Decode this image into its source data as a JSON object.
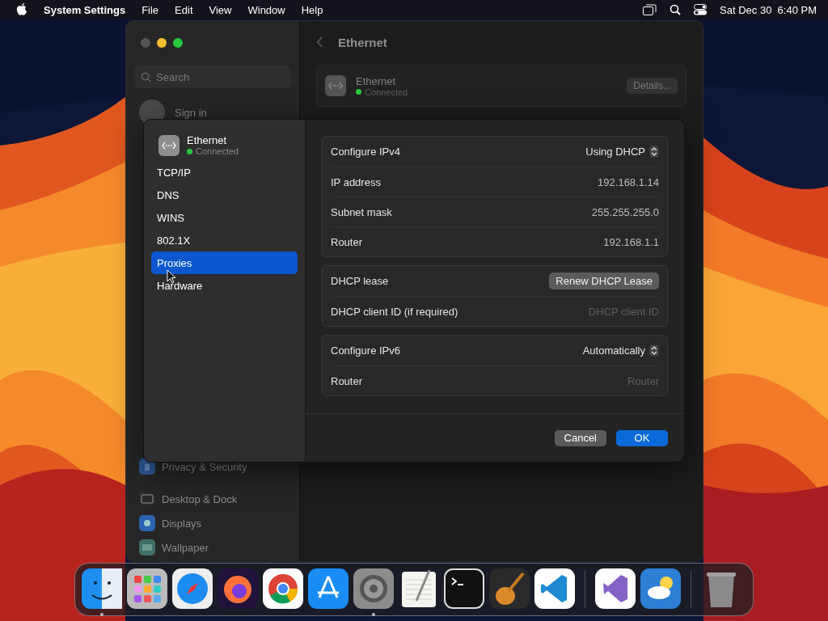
{
  "menu_bar": {
    "app_name": "System Settings",
    "menus": [
      "File",
      "Edit",
      "View",
      "Window",
      "Help"
    ],
    "clock": "Sat Dec 30  6:40 PM"
  },
  "window": {
    "search": {
      "placeholder": "Search"
    },
    "account": {
      "title": "Sign in"
    },
    "sidebar_items": [
      {
        "label": "Privacy & Security",
        "kind": "privacy"
      },
      {
        "label": "Desktop & Dock",
        "kind": "desktop"
      },
      {
        "label": "Displays",
        "kind": "displays"
      },
      {
        "label": "Wallpaper",
        "kind": "wallpaper"
      }
    ],
    "header": {
      "title": "Ethernet"
    },
    "service": {
      "name": "Ethernet",
      "status": "Connected",
      "button": "Details..."
    }
  },
  "sheet": {
    "service": {
      "name": "Ethernet",
      "status": "Connected"
    },
    "tabs": [
      {
        "label": "TCP/IP",
        "selected": false
      },
      {
        "label": "DNS",
        "selected": false
      },
      {
        "label": "WINS",
        "selected": false
      },
      {
        "label": "802.1X",
        "selected": false
      },
      {
        "label": "Proxies",
        "selected": true
      },
      {
        "label": "Hardware",
        "selected": false
      }
    ],
    "groups": [
      [
        {
          "label": "Configure IPv4",
          "kind": "popup",
          "value": "Using DHCP"
        },
        {
          "label": "IP address",
          "kind": "text",
          "value": "192.168.1.14"
        },
        {
          "label": "Subnet mask",
          "kind": "text",
          "value": "255.255.255.0"
        },
        {
          "label": "Router",
          "kind": "text",
          "value": "192.168.1.1"
        }
      ],
      [
        {
          "label": "DHCP lease",
          "kind": "button",
          "value": "Renew DHCP Lease"
        },
        {
          "label": "DHCP client ID (if required)",
          "kind": "field",
          "placeholder": "DHCP client ID"
        }
      ],
      [
        {
          "label": "Configure IPv6",
          "kind": "popup",
          "value": "Automatically"
        },
        {
          "label": "Router",
          "kind": "field",
          "placeholder": "Router"
        }
      ]
    ],
    "buttons": [
      {
        "label": "Cancel",
        "kind": "secondary"
      },
      {
        "label": "OK",
        "kind": "primary"
      }
    ]
  },
  "dock": {
    "sections": [
      [
        {
          "kind": "finder",
          "running": true
        },
        {
          "kind": "launchpad",
          "running": false
        },
        {
          "kind": "safari",
          "running": false
        },
        {
          "kind": "firefox",
          "running": false
        },
        {
          "kind": "chrome",
          "running": false
        },
        {
          "kind": "appstore",
          "running": false
        },
        {
          "kind": "settings",
          "running": true
        },
        {
          "kind": "textedit",
          "running": false
        },
        {
          "kind": "terminal",
          "running": false
        },
        {
          "kind": "garageband",
          "running": false
        },
        {
          "kind": "vscode",
          "running": false
        }
      ],
      [
        {
          "kind": "visualstudio",
          "running": false
        },
        {
          "kind": "weather",
          "running": false
        }
      ],
      [
        {
          "kind": "trash",
          "running": false
        }
      ]
    ]
  }
}
